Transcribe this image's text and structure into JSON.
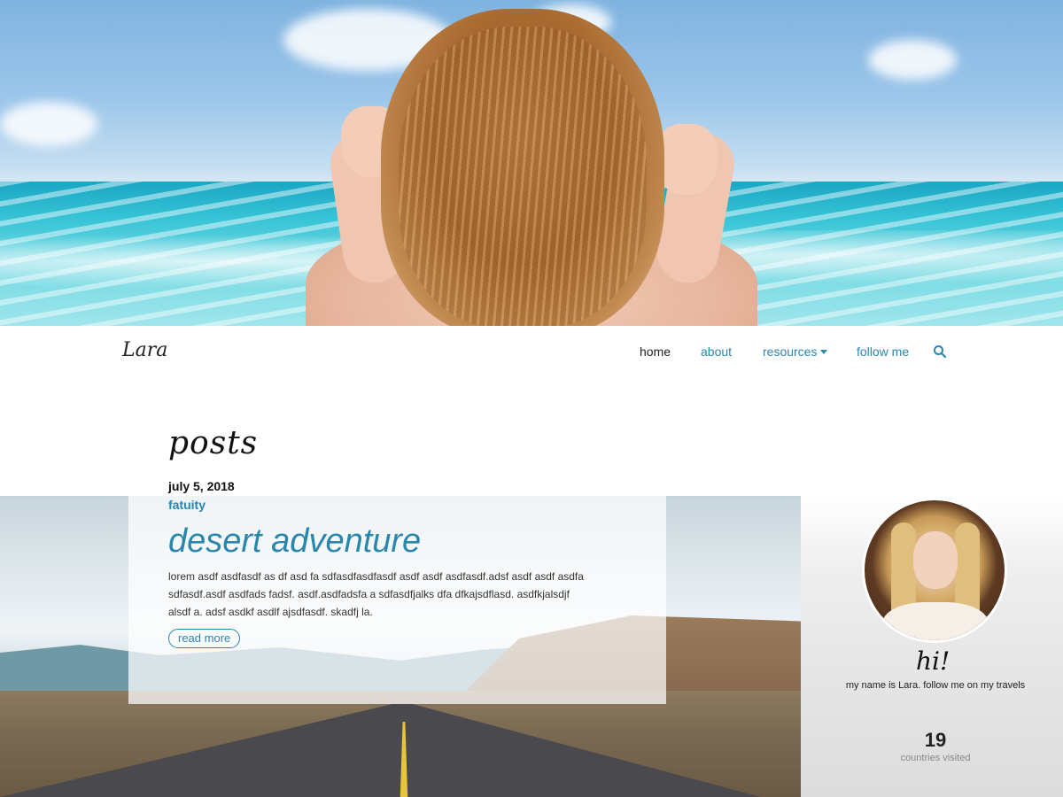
{
  "brand": "Lara",
  "nav": {
    "home": "home",
    "about": "about",
    "resources": "resources",
    "follow": "follow me",
    "search_icon": "search-icon",
    "accent_color": "#2a86ad"
  },
  "posts_heading": "posts",
  "featured_post": {
    "date": "july 5, 2018",
    "category": "fatuity",
    "title": "desert adventure",
    "excerpt": "lorem asdf asdfasdf as df asd fa sdfasdfasdfasdf asdf asdf asdfasdf.adsf asdf asdf asdfa sdfasdf.asdf asdfads fadsf. asdf.asdfadsfa a sdfasdfjalks dfa dfkajsdflasd. asdfkjalsdjf alsdf a. adsf asdkf asdlf ajsdfasdf. skadfj la.",
    "read_more": "read more"
  },
  "profile": {
    "greeting": "hi!",
    "tagline": "my name is Lara. follow me on my travels",
    "stat_value": "19",
    "stat_label": "countries visited"
  }
}
